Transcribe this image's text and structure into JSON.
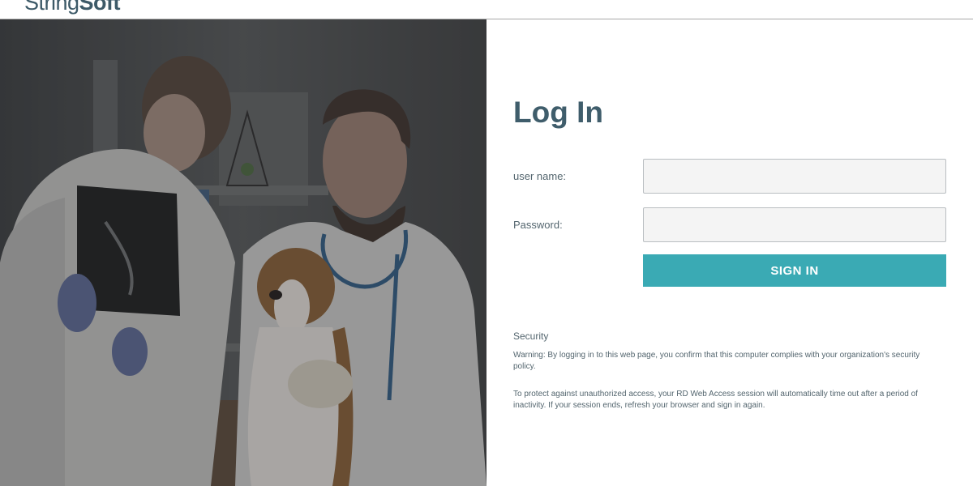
{
  "header": {
    "logo_part1": "String",
    "logo_part2": "Soft"
  },
  "login": {
    "title": "Log In",
    "username_label": "user name:",
    "username_value": "",
    "password_label": "Password:",
    "password_value": "",
    "signin_label": "SIGN IN"
  },
  "security": {
    "heading": "Security",
    "warning": "Warning: By logging in to this web page, you confirm that this computer complies with your organization's security policy.",
    "timeout": "To protect against unauthorized access, your RD Web Access session will automatically time out after a period of inactivity. If your session ends, refresh your browser and sign in again."
  },
  "colors": {
    "accent": "#3aaab4",
    "title": "#3f5d6b",
    "text": "#53656e"
  }
}
